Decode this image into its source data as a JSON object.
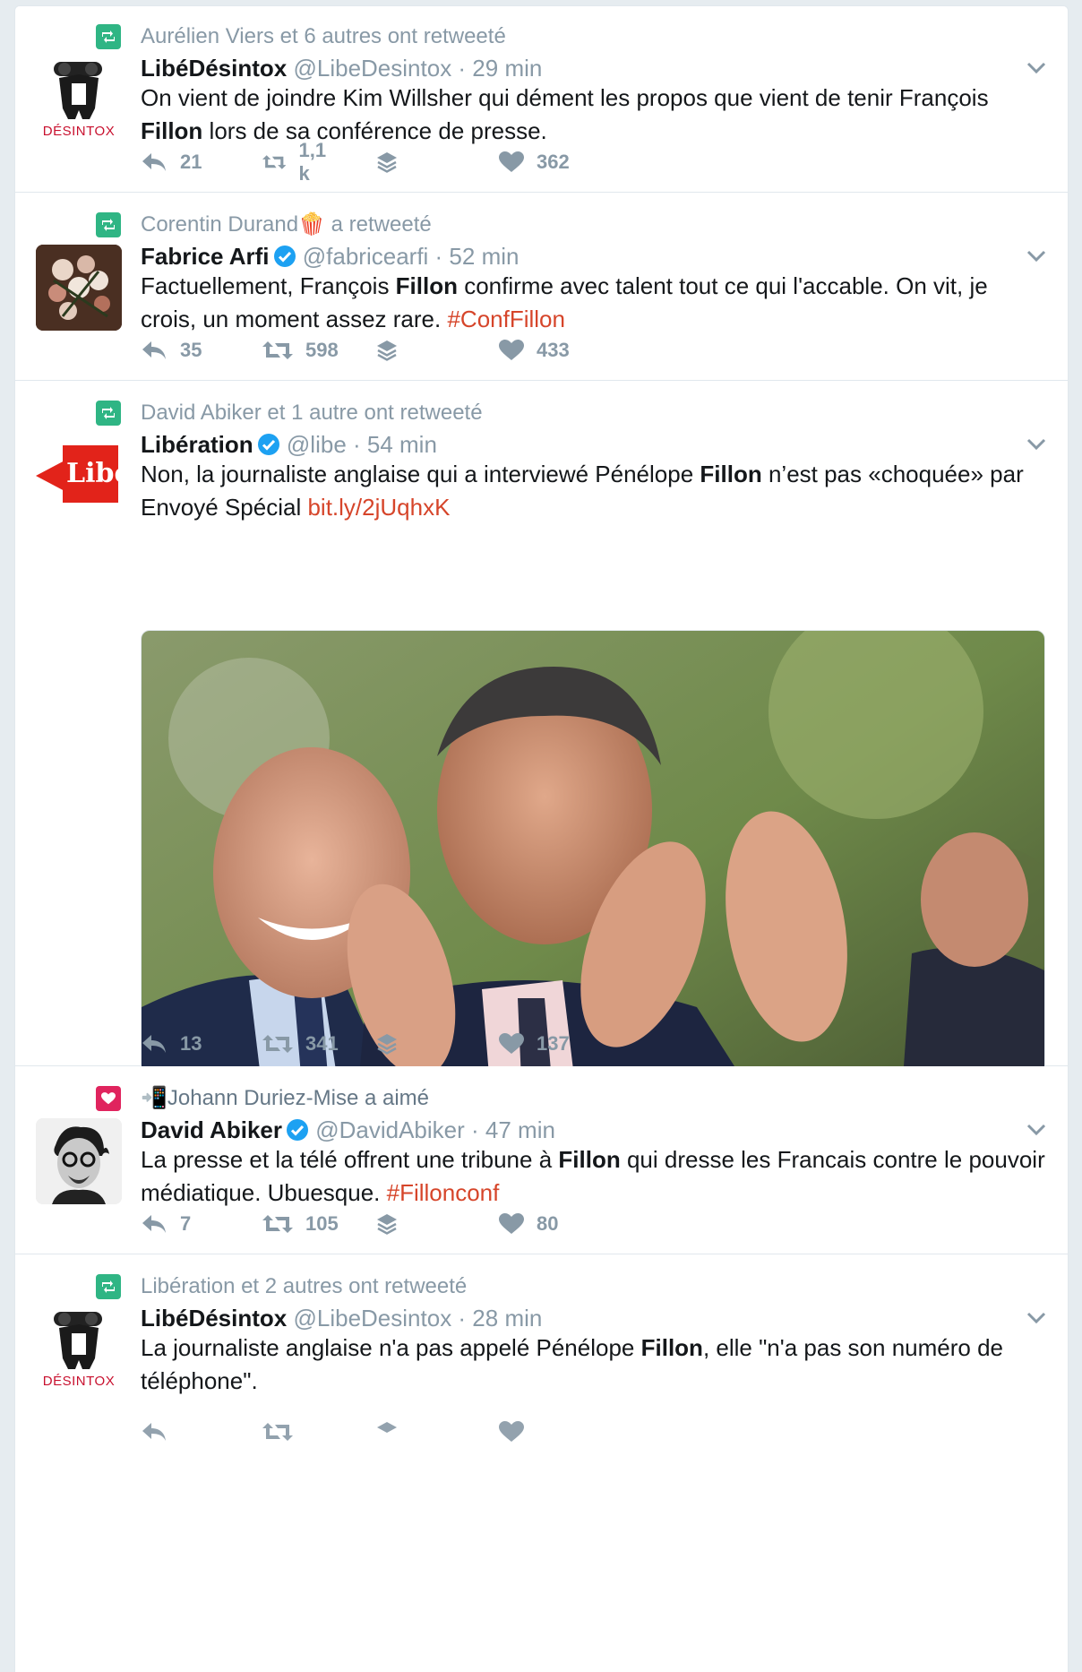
{
  "tweets": [
    {
      "context": "Aurélien Viers et 6 autres ont retweeté",
      "name": "LibéDésintox",
      "handle": "@LibeDesintox · 29 min",
      "text_parts": [
        "On vient de joindre Kim Willsher qui dément les propos que vient de tenir François ",
        "Fillon",
        " lors de sa conférence de presse."
      ],
      "replies": "21",
      "retweets": "1,1 k",
      "likes": "362",
      "avatar_label": "DÉSINTOX"
    },
    {
      "context": "Corentin Durand🍿 a retweeté",
      "name": "Fabrice Arfi",
      "handle": "@fabricearfi · 52 min",
      "text_parts": [
        "Factuellement, François ",
        "Fillon",
        " confirme avec talent tout ce qui l'accable. On vit, je crois, un moment assez rare. "
      ],
      "link": "#ConfFillon",
      "replies": "35",
      "retweets": "598",
      "likes": "433"
    },
    {
      "context": "David Abiker et 1 autre ont retweeté",
      "name": "Libération",
      "handle": "@libe · 54 min",
      "text_parts": [
        "Non, la journaliste anglaise qui a interviewé Pénélope ",
        "Fillon",
        " n’est pas «choquée» par Envoyé Spécial "
      ],
      "link": "bit.ly/2jUqhxK",
      "replies": "13",
      "retweets": "341",
      "likes": "137",
      "avatar_label": "Libé"
    },
    {
      "context": "📲Johann Duriez-Mise a aimé",
      "name": "David Abiker",
      "handle": "@DavidAbiker · 47 min",
      "text_parts": [
        "La presse et la télé offrent une tribune à ",
        "Fillon",
        " qui dresse les Francais contre le pouvoir médiatique. Ubuesque. "
      ],
      "link": "#Fillonconf",
      "replies": "7",
      "retweets": "105",
      "likes": "80"
    },
    {
      "context": "Libération et 2 autres ont retweeté",
      "name": "LibéDésintox",
      "handle": "@LibeDesintox · 28 min",
      "text_parts": [
        "La journaliste anglaise n'a pas appelé Pénélope ",
        "Fillon",
        ", elle \"n'a pas son numéro de téléphone\"."
      ],
      "avatar_label": "DÉSINTOX"
    }
  ],
  "colors": {
    "retweet_green": "#2fb584",
    "like_red": "#e0245e",
    "link": "#d6452a",
    "muted": "#8899a6",
    "verified_blue": "#1da1f2"
  },
  "icons": [
    "retweet-icon",
    "heart-icon",
    "reply-icon",
    "layers-icon",
    "chevron-down-icon",
    "verified-icon"
  ]
}
